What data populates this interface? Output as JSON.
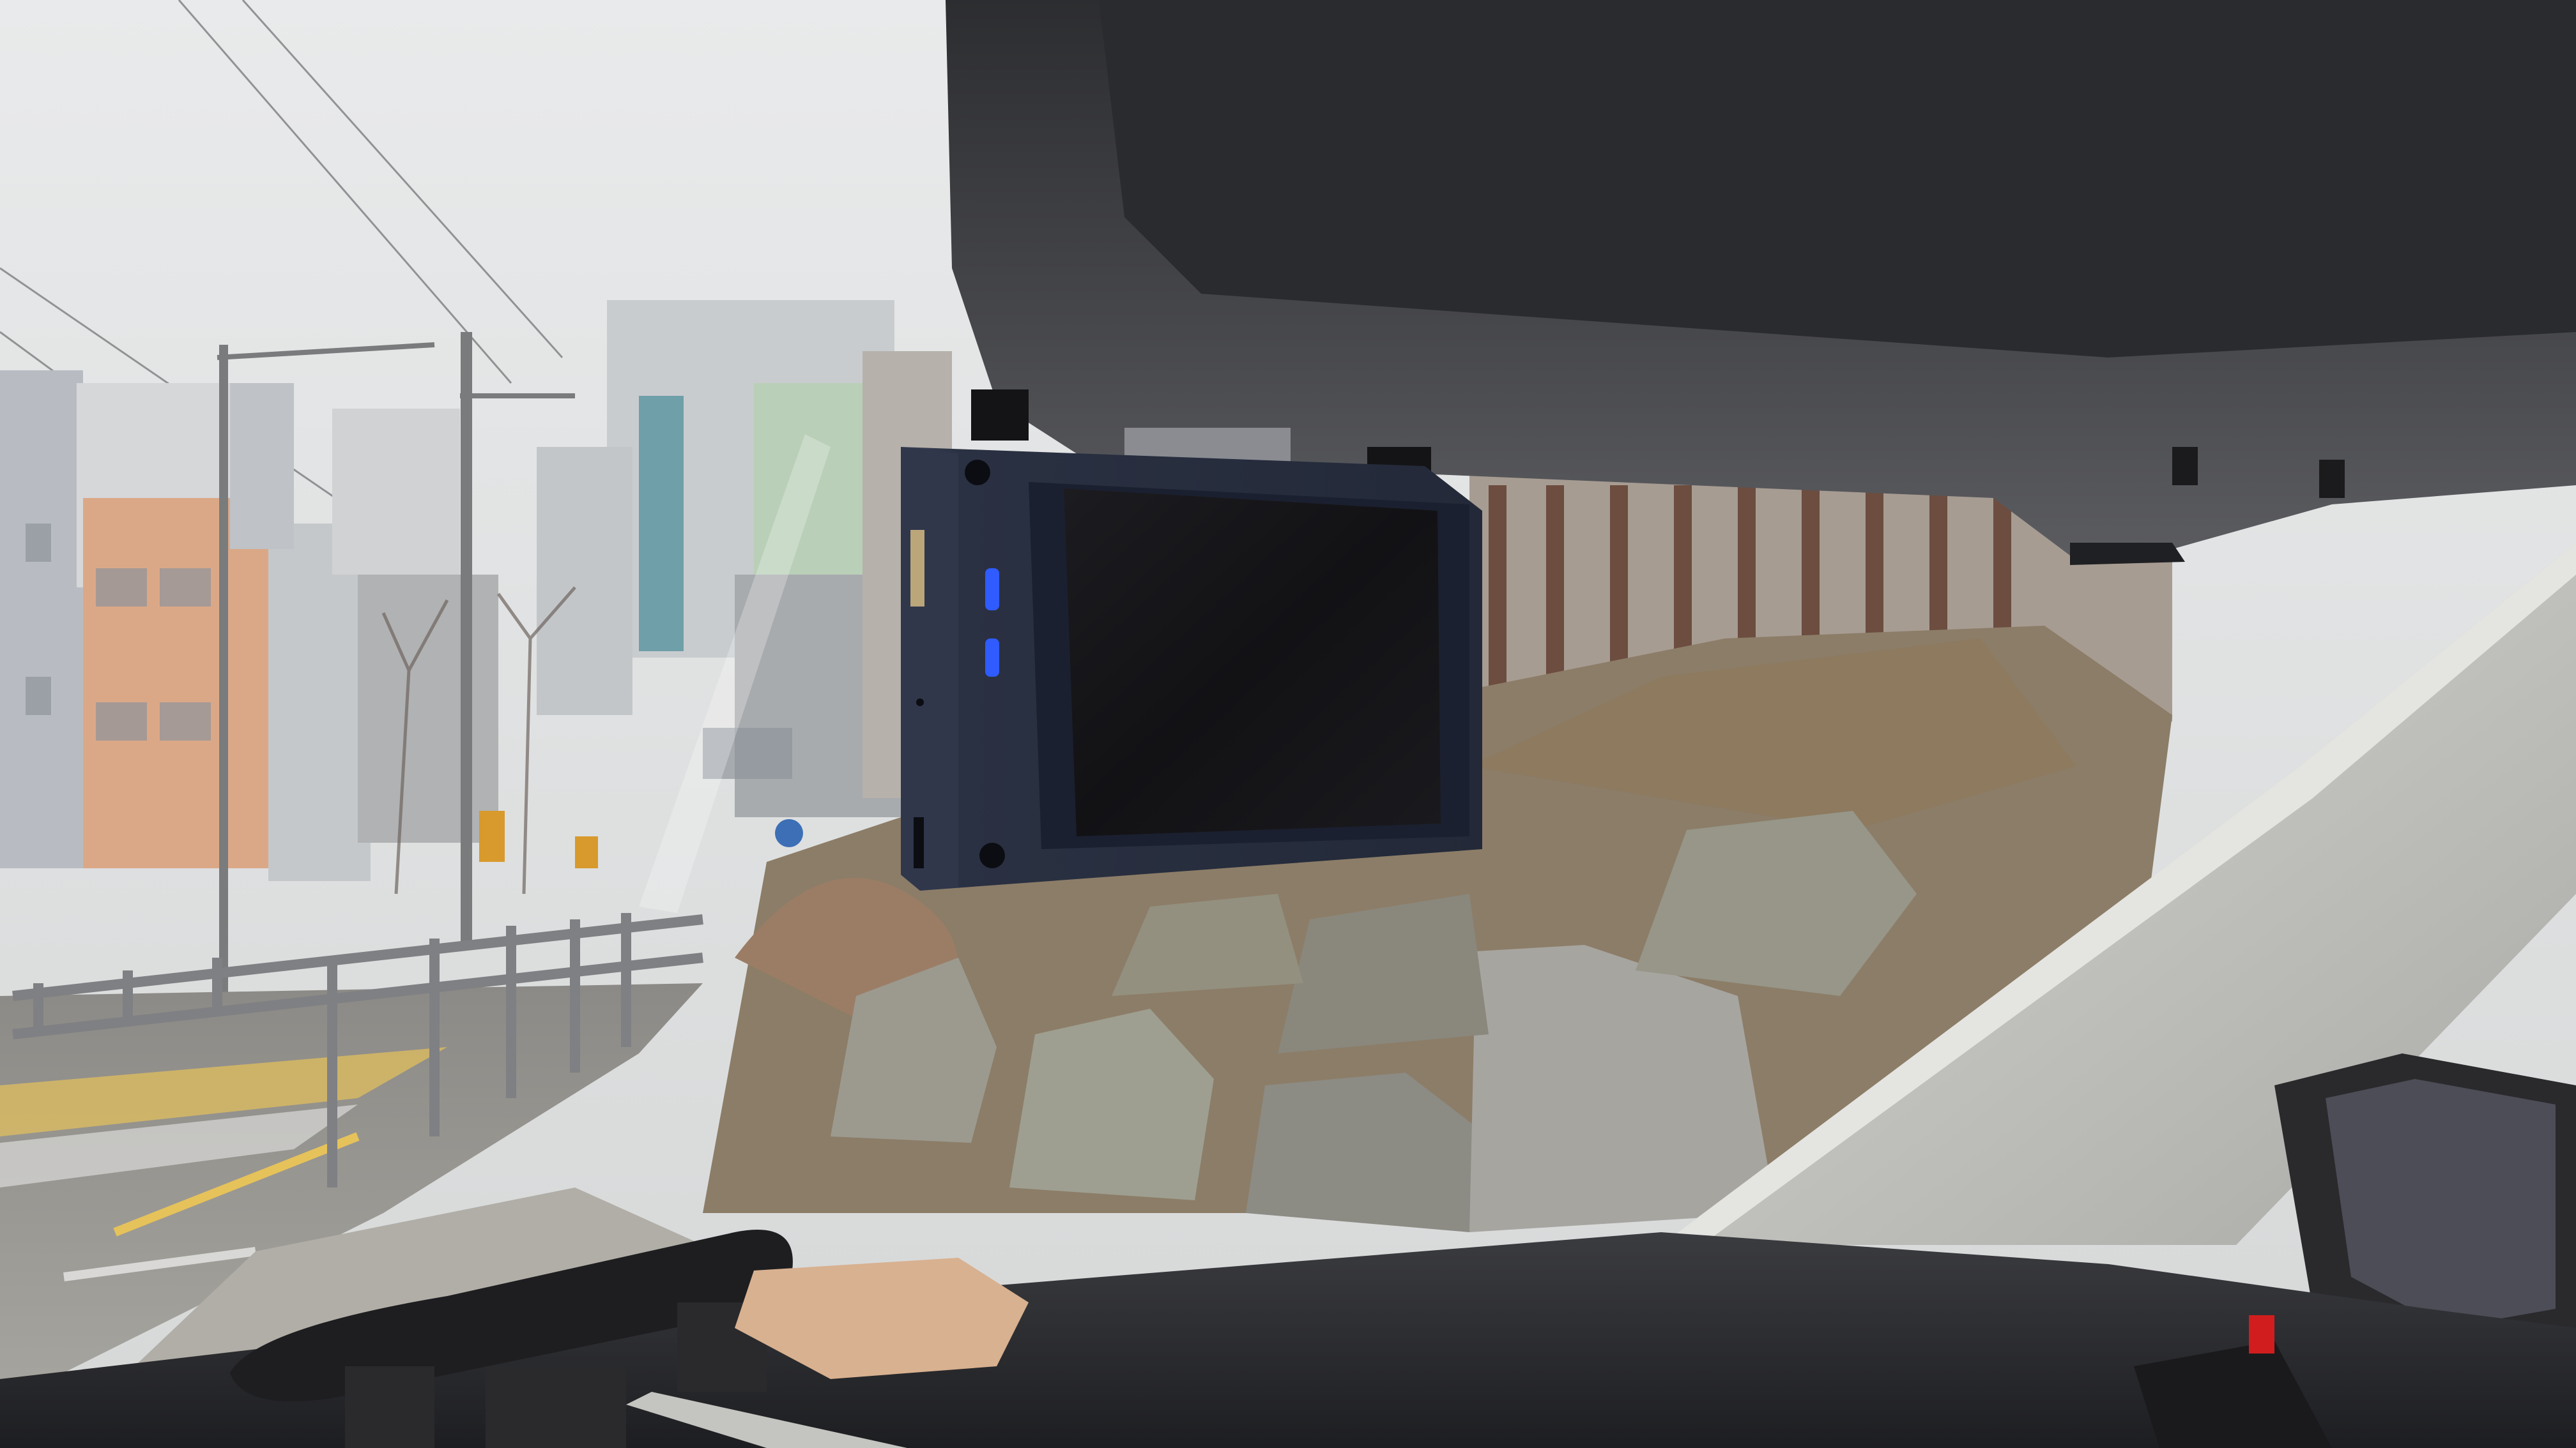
{
  "scene": {
    "subject": "dash-cam",
    "setting": "car-interior-windshield-view",
    "colors": {
      "sky": "#dfe1e2",
      "dashcam_body": "#2a3142",
      "dashcam_screen": "#151518",
      "indicator_led": "#2f5bff",
      "visor": "#3f4044",
      "dashboard": "#2b2c2f",
      "a_pillar": "#c8c8c5",
      "rocks": "#9b9a8e",
      "crosswalk": "#e6c25a"
    }
  }
}
